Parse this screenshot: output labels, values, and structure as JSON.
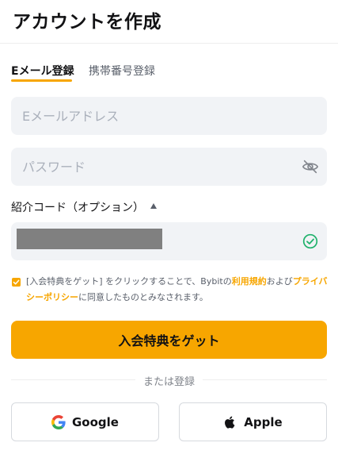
{
  "header": {
    "title": "アカウントを作成"
  },
  "tabs": [
    {
      "label": "Eメール登録",
      "active": true
    },
    {
      "label": "携帯番号登録",
      "active": false
    }
  ],
  "form": {
    "email_placeholder": "Eメールアドレス",
    "password_placeholder": "パスワード",
    "referral_label": "紹介コード（オプション）",
    "referral_status": "valid"
  },
  "agreement": {
    "checked": true,
    "text_before": "[入会特典をゲット] をクリックすることで、Bybitの",
    "terms_link": "利用規約",
    "text_middle": "および",
    "privacy_link": "プライバシーポリシー",
    "text_after": "に同意したものとみなされます。"
  },
  "cta": {
    "label": "入会特典をゲット"
  },
  "divider": {
    "label": "または登録"
  },
  "social": {
    "google_label": "Google",
    "apple_label": "Apple"
  },
  "colors": {
    "accent": "#f7a600",
    "field_bg": "#f1f3f6",
    "success": "#20b26c"
  }
}
